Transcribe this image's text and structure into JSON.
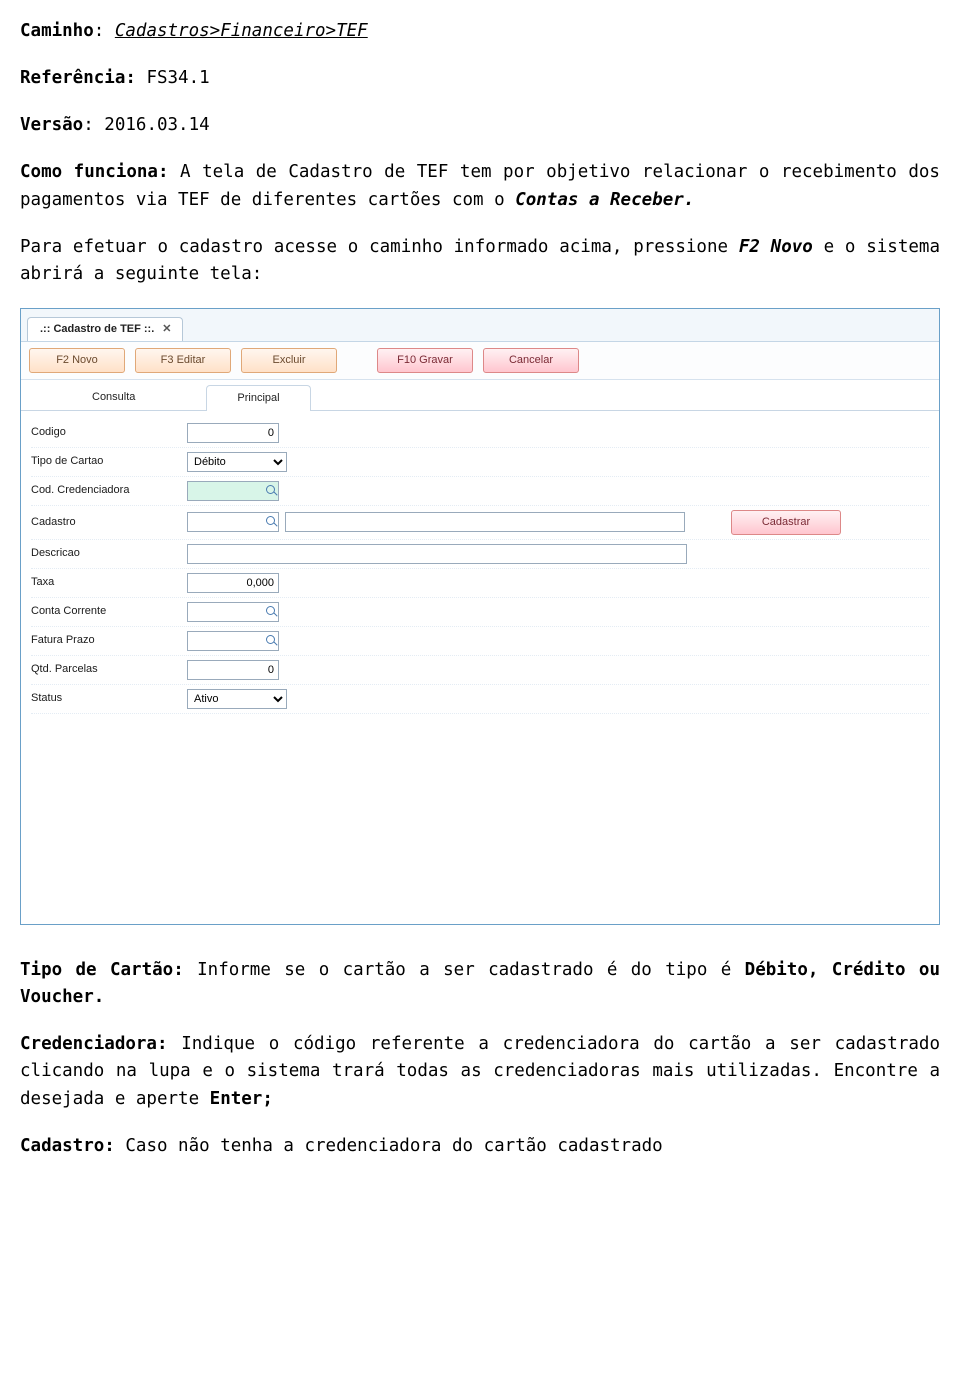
{
  "doc": {
    "path_label": "Caminho",
    "path_value": "Cadastros>Financeiro>TEF",
    "ref_label": "Referência:",
    "ref_value": "FS34.1",
    "ver_label": "Versão",
    "ver_value": "2016.03.14",
    "intro_label": "Como funciona:",
    "intro_text_1": " A tela de Cadastro de TEF tem por objetivo relacionar o recebimento dos pagamentos via TEF de diferentes cartões com o ",
    "intro_bold": "Contas a Receber.",
    "para2_a": "Para efetuar o cadastro acesse o caminho informado acima, pressione ",
    "para2_b": "F2 Novo",
    "para2_c": " e o sistema abrirá a seguinte tela:",
    "tipo_label": "Tipo de Cartão:",
    "tipo_text_a": "  Informe se o cartão a ser cadastrado é do tipo é ",
    "tipo_bold": "Débito, Crédito ou Voucher.",
    "cred_label": "Credenciadora:",
    "cred_text_a": "  Indique o código referente a credenciadora do cartão a ser cadastrado clicando na lupa e o sistema trará todas as credenciadoras mais utilizadas. Encontre a desejada e aperte ",
    "cred_bold": "Enter;",
    "cad_label": "Cadastro:",
    "cad_text": " Caso não tenha a credenciadora do cartão cadastrado"
  },
  "shot": {
    "title": ".:: Cadastro de TEF ::.",
    "toolbar": {
      "novo": "F2 Novo",
      "editar": "F3 Editar",
      "excluir": "Excluir",
      "gravar": "F10 Gravar",
      "cancelar": "Cancelar"
    },
    "subtabs": {
      "consulta": "Consulta",
      "principal": "Principal"
    },
    "fields": {
      "codigo_l": "Codigo",
      "codigo_v": "0",
      "tipo_l": "Tipo de Cartao",
      "tipo_v": "Débito",
      "codcred_l": "Cod. Credenciadora",
      "cadastro_l": "Cadastro",
      "cadastrar_btn": "Cadastrar",
      "desc_l": "Descricao",
      "taxa_l": "Taxa",
      "taxa_v": "0,000",
      "cc_l": "Conta Corrente",
      "fp_l": "Fatura Prazo",
      "qtd_l": "Qtd. Parcelas",
      "qtd_v": "0",
      "status_l": "Status",
      "status_v": "Ativo"
    }
  }
}
